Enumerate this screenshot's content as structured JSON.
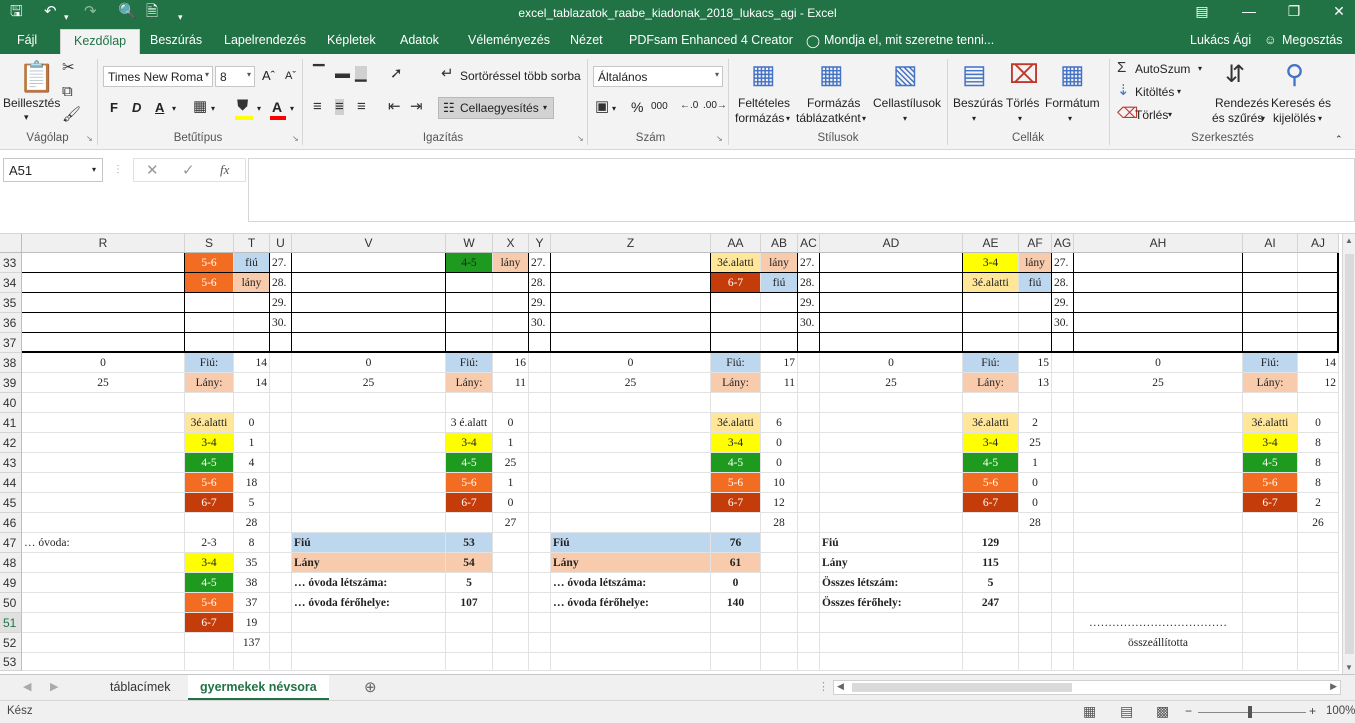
{
  "window": {
    "title": "excel_tablazatok_raabe_kiadonak_2018_lukacs_agi - Excel",
    "user": "Lukács Ági",
    "share": "Megosztás",
    "tell_me": "Mondja el, mit szeretne tenni..."
  },
  "ribbon_tabs": [
    "Fájl",
    "Kezdőlap",
    "Beszúrás",
    "Lapelrendezés",
    "Képletek",
    "Adatok",
    "Véleményezés",
    "Nézet",
    "PDFsam Enhanced 4 Creator"
  ],
  "ribbon": {
    "paste": "Beillesztés",
    "clipboard": "Vágólap",
    "font_name": "Times New Roma",
    "font_size": "8",
    "font_group": "Betűtípus",
    "bold": "F",
    "italic": "D",
    "underline": "A",
    "sort_more": "Sortöréssel több sorba",
    "merge": "Cellaegyesítés",
    "align_group": "Igazítás",
    "number_format": "Általános",
    "number_group": "Szám",
    "cond_fmt_1": "Feltételes",
    "cond_fmt_2": "formázás",
    "fmt_table_1": "Formázás",
    "fmt_table_2": "táblázatként",
    "cell_styles": "Cellastílusok",
    "styles_group": "Stílusok",
    "insert": "Beszúrás",
    "delete": "Törlés",
    "format": "Formátum",
    "cells_group": "Cellák",
    "autosum": "AutoSzum",
    "fill": "Kitöltés",
    "clear": "Törlés",
    "sort_1": "Rendezés",
    "sort_2": "és szűrés",
    "find_1": "Keresés és",
    "find_2": "kijelölés",
    "edit_group": "Szerkesztés"
  },
  "formula": {
    "namebox": "A51",
    "fx": "fx",
    "value": ""
  },
  "columns": [
    "R",
    "S",
    "T",
    "U",
    "V",
    "W",
    "X",
    "Y",
    "Z",
    "AA",
    "AB",
    "AC",
    "AD",
    "AE",
    "AF",
    "AG",
    "AH",
    "AI",
    "AJ"
  ],
  "rows": [
    "33",
    "34",
    "35",
    "36",
    "37",
    "38",
    "39",
    "40",
    "41",
    "42",
    "43",
    "44",
    "45",
    "46",
    "47",
    "48",
    "49",
    "50",
    "51",
    "52",
    "53"
  ],
  "selected_row": "51",
  "colors": {
    "green": "#217346",
    "age_lt3": "#ffe699",
    "age_3_4": "#ffff00",
    "age_4_5": "#1e9a1e",
    "age_5_6": "#f26c21",
    "age_6_7": "#c43c0a",
    "boy": "#bdd7ee",
    "girl": "#f8cbad"
  },
  "cells": {
    "S33": "5-6",
    "T33": "fiú",
    "U33": "27.",
    "W33": "4-5",
    "X33": "lány",
    "Y33": "27.",
    "AA33": "3é.alatti",
    "AB33": "lány",
    "AC33": "27.",
    "AE33": "3-4",
    "AF33": "lány",
    "AG33": "27.",
    "S34": "5-6",
    "T34": "lány",
    "U34": "28.",
    "Y34": "28.",
    "AA34": "6-7",
    "AB34": "fiú",
    "AC34": "28.",
    "AE34": "3é.alatti",
    "AF34": "fiú",
    "AG34": "28.",
    "U35": "29.",
    "Y35": "29.",
    "AC35": "29.",
    "AG35": "29.",
    "U36": "30.",
    "Y36": "30.",
    "AC36": "30.",
    "AG36": "30.",
    "R38": "0",
    "S38": "Fiú:",
    "T38": "14",
    "V38": "0",
    "W38": "Fiú:",
    "X38": "16",
    "Z38": "0",
    "AA38": "Fiú:",
    "AB38": "17",
    "AD38": "0",
    "AE38": "Fiú:",
    "AF38": "15",
    "AH38": "0",
    "AI38": "Fiú:",
    "AJ38": "14",
    "R39": "25",
    "S39": "Lány:",
    "T39": "14",
    "V39": "25",
    "W39": "Lány:",
    "X39": "11",
    "Z39": "25",
    "AA39": "Lány:",
    "AB39": "11",
    "AD39": "25",
    "AE39": "Lány:",
    "AF39": "13",
    "AH39": "25",
    "AI39": "Lány:",
    "AJ39": "12",
    "S41": "3é.alatti",
    "T41": "0",
    "W41": "3 é.alatt",
    "X41": "0",
    "AA41": "3é.alatti",
    "AB41": "6",
    "AE41": "3é.alatti",
    "AF41": "2",
    "AI41": "3é.alatti",
    "AJ41": "0",
    "S42": "3-4",
    "T42": "1",
    "W42": "3-4",
    "X42": "1",
    "AA42": "3-4",
    "AB42": "0",
    "AE42": "3-4",
    "AF42": "25",
    "AI42": "3-4",
    "AJ42": "8",
    "S43": "4-5",
    "T43": "4",
    "W43": "4-5",
    "X43": "25",
    "AA43": "4-5",
    "AB43": "0",
    "AE43": "4-5",
    "AF43": "1",
    "AI43": "4-5",
    "AJ43": "8",
    "S44": "5-6",
    "T44": "18",
    "W44": "5-6",
    "X44": "1",
    "AA44": "5-6",
    "AB44": "10",
    "AE44": "5-6",
    "AF44": "0",
    "AI44": "5-6",
    "AJ44": "8",
    "S45": "6-7",
    "T45": "5",
    "W45": "6-7",
    "X45": "0",
    "AA45": "6-7",
    "AB45": "12",
    "AE45": "6-7",
    "AF45": "0",
    "AI45": "6-7",
    "AJ45": "2",
    "T46": "28",
    "X46": "27",
    "AB46": "28",
    "AF46": "28",
    "AJ46": "26",
    "R47": "… óvoda:",
    "S47": "2-3",
    "T47": "8",
    "V47": "Fiú",
    "W47": "53",
    "Z47": "Fiú",
    "AA47": "76",
    "AD47": "Fiú",
    "AE47": "129",
    "S48": "3-4",
    "T48": "35",
    "V48": "Lány",
    "W48": "54",
    "Z48": "Lány",
    "AA48": "61",
    "AD48": "Lány",
    "AE48": "115",
    "S49": "4-5",
    "T49": "38",
    "V49": "… óvoda létszáma:",
    "W49": "5",
    "Z49": "… óvoda létszáma:",
    "AA49": "0",
    "AD49": "Összes létszám:",
    "AE49": "5",
    "S50": "5-6",
    "T50": "37",
    "V50": "… óvoda férőhelye:",
    "W50": "107",
    "Z50": "… óvoda férőhelye:",
    "AA50": "140",
    "AD50": "Összes férőhely:",
    "AE50": "247",
    "S51": "6-7",
    "T51": "19",
    "AH51": "………………………………",
    "T52": "137",
    "AH52": "összeállította"
  },
  "sheets": [
    "táblacímek",
    "gyermekek névsora"
  ],
  "active_sheet": "gyermekek névsora",
  "status": {
    "text": "Kész",
    "zoom": "100%"
  }
}
